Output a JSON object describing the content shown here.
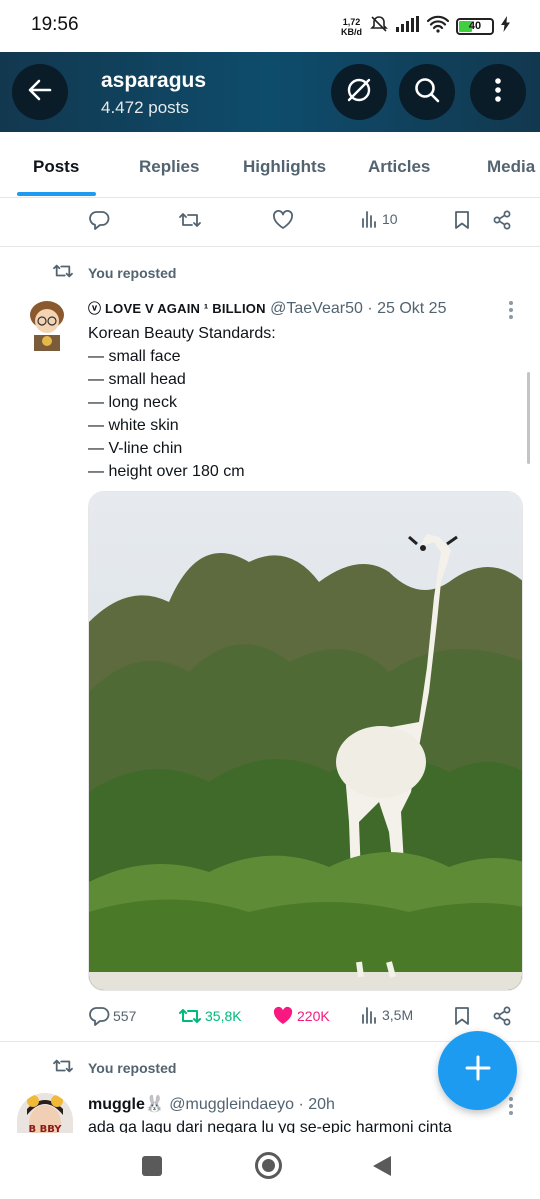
{
  "status_bar": {
    "time": "19:56",
    "net_speed_value": "1,72",
    "net_speed_unit": "KB/d",
    "battery": "40"
  },
  "header": {
    "title": "asparagus",
    "subtitle": "4.472 posts"
  },
  "tabs": [
    {
      "label": "Posts",
      "active": true
    },
    {
      "label": "Replies",
      "active": false
    },
    {
      "label": "Highlights",
      "active": false
    },
    {
      "label": "Articles",
      "active": false
    },
    {
      "label": "Media",
      "active": false
    }
  ],
  "top_actions": {
    "views": "10"
  },
  "post1": {
    "reposted_label": "You reposted",
    "display_name": "ⓥ LOVE V AGAIN ¹ BILLION",
    "handle": "@TaeVear50",
    "date": "· 25 Okt 25",
    "text": "Korean Beauty Standards:\n— small face\n— small head\n— long neck\n— white skin\n— V-line chin\n— height over 180 cm",
    "image_icon": "white-giraffe-photo",
    "replies": "557",
    "reposts": "35,8K",
    "likes": "220K",
    "views": "3,5M"
  },
  "post2": {
    "reposted_label": "You reposted",
    "display_name": "muggle🐰",
    "handle": "@muggleindaeyo",
    "date": "· 20h",
    "text": "ada ga lagu dari negara lu yg se-epic harmoni cinta"
  },
  "colors": {
    "accent": "#1d9bf0",
    "repost_green": "#00ba7c",
    "like_pink": "#f91880",
    "header_bg": "#0e4c6c"
  }
}
